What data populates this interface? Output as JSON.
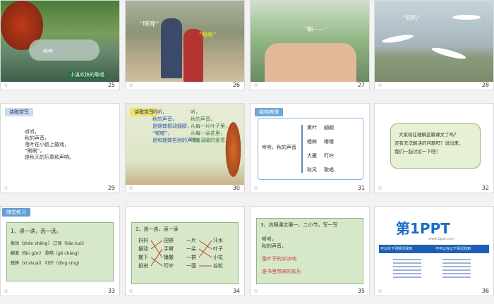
{
  "slides": [
    {
      "num": "25",
      "label1": "小溪欢快的歌唱",
      "label2": "哗哗"
    },
    {
      "num": "26",
      "label1": "“哗哗”",
      "label2": "“哈哈”"
    },
    {
      "num": "27",
      "label1": "“唰——”"
    },
    {
      "num": "28",
      "label1": "“叽叽”"
    },
    {
      "num": "29",
      "ribbon": "诗歌赏写",
      "poem": [
        "听听，",
        "秋的声音，",
        "落叶在小路上嬉戏，",
        "“刷刷”，",
        "是秋天的乐章和声响。"
      ]
    },
    {
      "num": "30",
      "ribbon": "诗歌赏写",
      "poemA": [
        "听听，",
        "秋的声音，",
        "是蟋蟀振动翅膀，",
        "“嘘嘘”，",
        "是和蟋蟀告别的声音。"
      ],
      "poemB": [
        "听，",
        "秋的声音，",
        "从每一片叶子里，",
        "从每一朵花里，",
        "带着温暖的爱意……"
      ]
    },
    {
      "num": "31",
      "ribbon": "结构梳理",
      "center": "听听，秋的声音",
      "items": [
        [
          "黄叶",
          "翩翩"
        ],
        [
          "蟋蟀",
          "嚯嚯"
        ],
        [
          "大雁",
          "叮咛"
        ],
        [
          "秋风",
          "歌唱"
        ]
      ]
    },
    {
      "num": "32",
      "q1": "大家现在理解这篇课文了吗？",
      "q2": "还有无法解决的问题吗？说出来，",
      "q3": "我们一起讨论一下吧！"
    },
    {
      "num": "33",
      "ribbon": "随堂练习",
      "title": "1、读一读，选一选。",
      "rows": [
        "振动（zhèn zhēng）  辽阔（liáo kuò）",
        "翻滚（fān gǔn）  歌唱（gē chàng）",
        "蟋蟀（xī shuài）  叮咛（dīng níng）"
      ]
    },
    {
      "num": "34",
      "title": "2、连一连，读一读",
      "left": [
        "抖抖",
        "振动",
        "撒下",
        "投进"
      ],
      "mid": [
        "田野",
        "手臂",
        "播撒",
        "叮咛"
      ],
      "right1": [
        "一片",
        "一朵",
        "一群",
        "一面"
      ],
      "right2": [
        "汗水",
        "叶子",
        "小花",
        "谷粒"
      ]
    },
    {
      "num": "35",
      "title": "3、仿照课文第一、二小节，写一写",
      "lines": [
        "听听，",
        "秋的声音，",
        "是叶子的沙沙响",
        "是书里带来的欢乐"
      ]
    },
    {
      "num": "36",
      "logo": "第1PPT",
      "site": "www.1ppt.com",
      "bar1": "可以在下列情况找到",
      "bar2": "不可以在以下情况找到"
    }
  ]
}
